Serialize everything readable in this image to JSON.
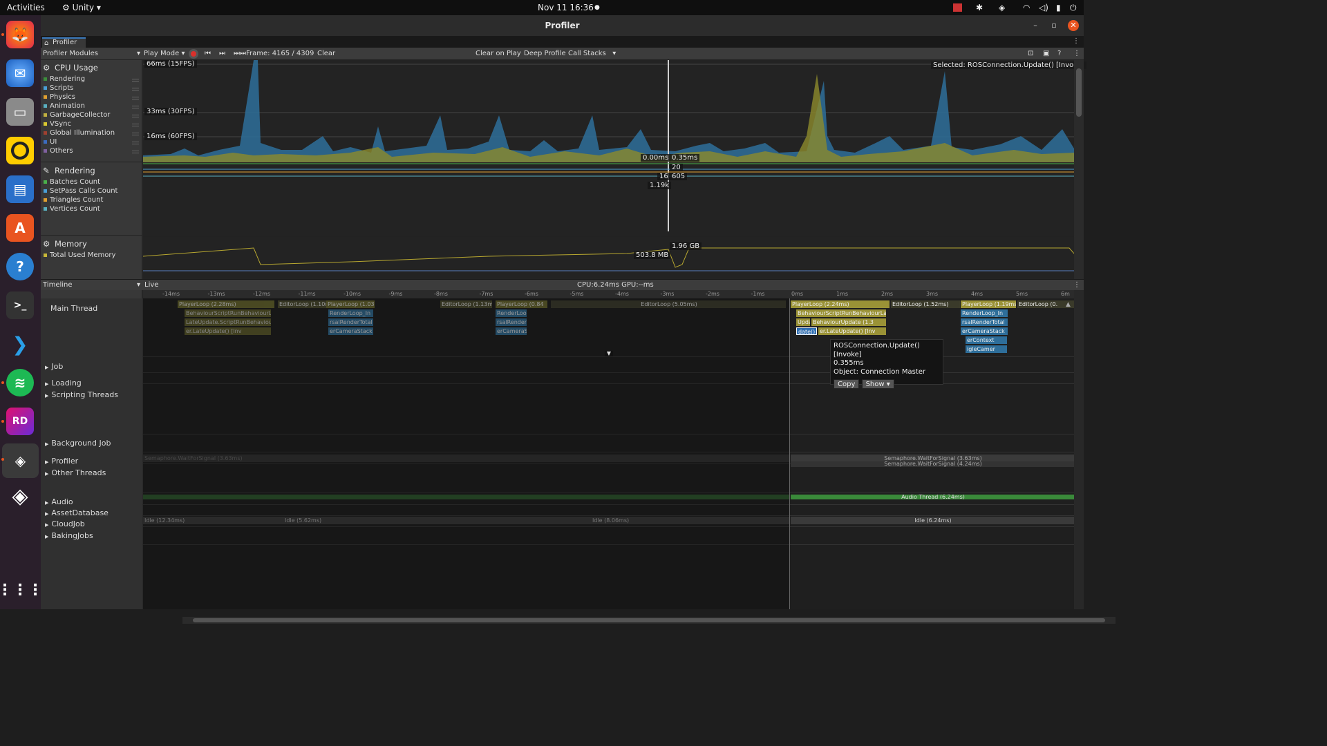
{
  "topbar": {
    "activities": "Activities",
    "app": "Unity",
    "datetime": "Nov 11  16:36"
  },
  "window": {
    "title": "Profiler",
    "tab": "Profiler"
  },
  "toolbar": {
    "modules": "Profiler Modules",
    "mode": "Play Mode",
    "frame": "Frame: 4165 / 4309",
    "clear": "Clear",
    "clear_on_play": "Clear on Play",
    "deep_profile": "Deep Profile",
    "call_stacks": "Call Stacks"
  },
  "cpu": {
    "title": "CPU Usage",
    "items": [
      {
        "label": "Rendering",
        "color": "#3c8f3c"
      },
      {
        "label": "Scripts",
        "color": "#4a9fd6"
      },
      {
        "label": "Physics",
        "color": "#e0a030"
      },
      {
        "label": "Animation",
        "color": "#5ab0c0"
      },
      {
        "label": "GarbageCollector",
        "color": "#c0b040"
      },
      {
        "label": "VSync",
        "color": "#d8c830"
      },
      {
        "label": "Global Illumination",
        "color": "#a04030"
      },
      {
        "label": "UI",
        "color": "#3c6cc0"
      },
      {
        "label": "Others",
        "color": "#8060a0"
      }
    ],
    "fps66": "66ms (15FPS)",
    "fps33": "33ms (30FPS)",
    "fps16": "16ms (60FPS)",
    "selected": "Selected: ROSConnection.Update() [Invoke]",
    "val_a": "0.00ms",
    "val_b": "0.35ms"
  },
  "rendering": {
    "title": "Rendering",
    "items": [
      {
        "label": "Batches Count",
        "color": "#4ab04a"
      },
      {
        "label": "SetPass Calls Count",
        "color": "#4a9fd6"
      },
      {
        "label": "Triangles Count",
        "color": "#e0a030"
      },
      {
        "label": "Vertices Count",
        "color": "#5ab0c0"
      }
    ],
    "v1": "20",
    "v2": "16",
    "v3": "605",
    "v4": "1.19k"
  },
  "memory": {
    "title": "Memory",
    "items": [
      {
        "label": "Total Used Memory",
        "color": "#c8b838"
      }
    ],
    "v1": "1.96 GB",
    "v2": "503.8 MB"
  },
  "timeline": {
    "label": "Timeline",
    "live": "Live",
    "cpu_gpu": "CPU:6.24ms  GPU:--ms",
    "ruler_prev": [
      "-14ms",
      "-13ms",
      "-12ms",
      "-11ms",
      "-10ms",
      "-9ms",
      "-8ms",
      "-7ms",
      "-6ms",
      "-5ms",
      "-4ms",
      "-3ms",
      "-2ms",
      "-1ms"
    ],
    "ruler_cur": [
      "0ms",
      "1ms",
      "2ms",
      "3ms",
      "4ms",
      "5ms",
      "6m"
    ],
    "threads": [
      "Main Thread",
      "Job",
      "Loading",
      "Scripting Threads",
      "Background Job",
      "Profiler",
      "Other Threads",
      "Audio",
      "AssetDatabase",
      "CloudJob",
      "BakingJobs"
    ],
    "bars": {
      "pl1": "PlayerLoop (2.28ms)",
      "el1": "EditorLoop (1.10ms)",
      "pl2": "PlayerLoop (1.03m",
      "el2": "EditorLoop (1.13ms)",
      "pl3": "PlayerLoop (0.84",
      "el3": "EditorLoop (5.05ms)",
      "pl4": "PlayerLoop (2.24ms)",
      "el4": "EditorLoop (1.52ms)",
      "pl5": "PlayerLoop (1.19ms)",
      "el5": "EditorLoop (0.",
      "bh": "BehaviourScriptRunBehaviourLat",
      "lu": "LateUpdate.ScriptRunBehaviourLate",
      "bu": "BehaviourUpdate (1.3",
      "late": "er.LateUpdate() [Inv",
      "upd": "Update",
      "dated": "date()",
      "rl": "RenderLoop_In",
      "rt": "rsalRenderTotal",
      "cs": "erCameraStack",
      "ctx": "erContext",
      "cam": "igleCamer",
      "idle1": "Idle (12.34ms)",
      "idle2": "Idle (5.62ms)",
      "idle3": "Idle (8.06ms)",
      "idle4": "Idle (6.24ms)",
      "sem": "Semaphore.WaitForSignal (3.63ms)",
      "sem2": "Semaphore.WaitForSignal (4.24ms)",
      "audio": "Audio Thread (6.24ms)"
    }
  },
  "tooltip": {
    "name": "ROSConnection.Update() [Invoke]",
    "time": "0.355ms",
    "object": "Object: Connection Master",
    "copy": "Copy",
    "show": "Show"
  },
  "dock": [
    "firefox-icon",
    "thunderbird-icon",
    "files-icon",
    "rhythmbox-icon",
    "writer-icon",
    "software-icon",
    "help-icon",
    "terminal-icon",
    "vscode-icon",
    "spotify-icon",
    "rider-icon",
    "unity-hub-icon",
    "unity-icon",
    "apps-grid-icon"
  ],
  "colors": {
    "scripts": "#4a9fd6",
    "vsync": "#a8a028",
    "rendering": "#3c8f3c",
    "selection": "#2f6fb3"
  }
}
